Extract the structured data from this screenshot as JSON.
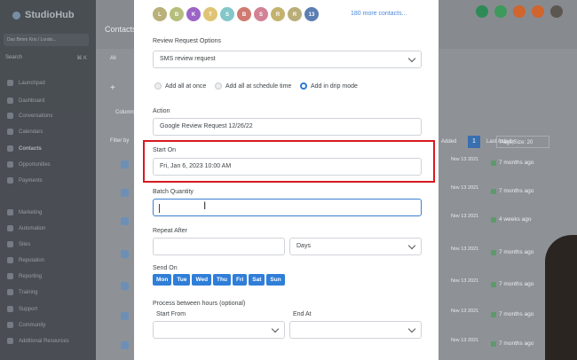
{
  "app": {
    "name": "StudioHub",
    "account": "Dan Bimm Kris / Londo...",
    "search_label": "Search",
    "search_shortcut": "⌘ K"
  },
  "sidebar": {
    "items": [
      {
        "label": "Launchpad"
      },
      {
        "label": "Dashboard"
      },
      {
        "label": "Conversations"
      },
      {
        "label": "Calendars"
      },
      {
        "label": "Contacts",
        "active": true
      },
      {
        "label": "Opportunities"
      },
      {
        "label": "Payments"
      },
      {
        "label": "Marketing"
      },
      {
        "label": "Automation"
      },
      {
        "label": "Sites"
      },
      {
        "label": "Reputation"
      },
      {
        "label": "Reporting"
      },
      {
        "label": "Training"
      },
      {
        "label": "Support"
      },
      {
        "label": "Community"
      },
      {
        "label": "Additional Resources"
      }
    ]
  },
  "background": {
    "title": "Contacts",
    "tab": "All",
    "columns_label": "Columns",
    "filter_label": "Filter by",
    "last_activity_header": "Last Activity",
    "added_header": "Added",
    "page_number": "1",
    "page_size": "Page Size: 20",
    "rows": [
      {
        "date": "Nov 13 2021",
        "activity": "7 months ago"
      },
      {
        "date": "Nov 13 2021",
        "activity": "7 months ago"
      },
      {
        "date": "Nov 13 2021",
        "activity": "4 weeks ago"
      },
      {
        "date": "Nov 13 2021",
        "activity": "7 months ago"
      },
      {
        "date": "Nov 13 2021",
        "activity": "7 months ago"
      },
      {
        "date": "Nov 13 2021",
        "activity": "7 months ago"
      },
      {
        "date": "Nov 13 2021",
        "activity": "7 months ago"
      }
    ]
  },
  "recipients": {
    "chips": [
      {
        "letter": "L",
        "color": "#b9b07a"
      },
      {
        "letter": "B",
        "color": "#b6be7c"
      },
      {
        "letter": "K",
        "color": "#9b64c6"
      },
      {
        "letter": "T",
        "color": "#e0c476"
      },
      {
        "letter": "S",
        "color": "#84c7c9"
      },
      {
        "letter": "B",
        "color": "#d07a72"
      },
      {
        "letter": "S",
        "color": "#d28295"
      },
      {
        "letter": "R",
        "color": "#c3b36e"
      },
      {
        "letter": "R",
        "color": "#b9ad79"
      },
      {
        "letter": "13",
        "color": "#5c7fb3"
      }
    ],
    "more_label": "180 more contacts..."
  },
  "form": {
    "review_options_label": "Review Request Options",
    "review_options_value": "SMS review request",
    "radio_all_once": "Add all at once",
    "radio_all_schedule": "Add all at schedule time",
    "radio_drip": "Add in drip mode",
    "action_label": "Action",
    "action_value": "Google Review Request 12/26/22",
    "start_on_label": "Start On",
    "start_on_value": "Fri, Jan 6, 2023 10:00 AM",
    "batch_quantity_label": "Batch Quantity",
    "batch_quantity_value": "",
    "repeat_after_label": "Repeat After",
    "repeat_after_value": "",
    "repeat_unit": "Days",
    "send_on_label": "Send On",
    "days": [
      "Mon",
      "Tue",
      "Wed",
      "Thu",
      "Fri",
      "Sat",
      "Sun"
    ],
    "process_hours_label": "Process between hours (optional)",
    "start_from_label": "Start From",
    "end_at_label": "End At"
  },
  "colors": {
    "accent": "#2f7ed8",
    "highlight": "#d8191f"
  }
}
